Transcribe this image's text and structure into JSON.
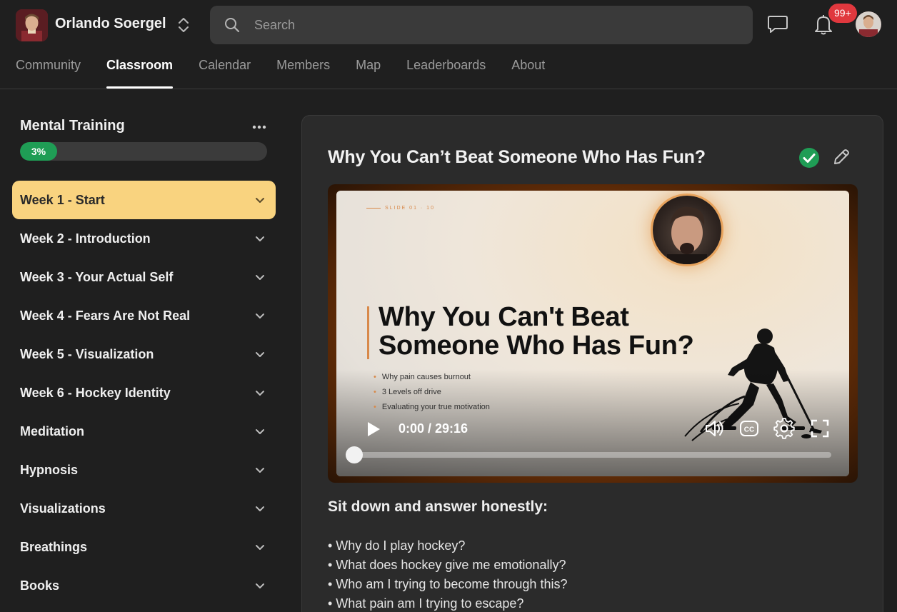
{
  "header": {
    "group_name": "Orlando Soergel",
    "search_placeholder": "Search",
    "notifications_badge": "99+",
    "tabs": [
      {
        "label": "Community",
        "active": false
      },
      {
        "label": "Classroom",
        "active": true
      },
      {
        "label": "Calendar",
        "active": false
      },
      {
        "label": "Members",
        "active": false
      },
      {
        "label": "Map",
        "active": false
      },
      {
        "label": "Leaderboards",
        "active": false
      },
      {
        "label": "About",
        "active": false
      }
    ]
  },
  "sidebar": {
    "course_title": "Mental Training",
    "progress_label": "3%",
    "progress_percent": 3,
    "modules": [
      {
        "label": "Week 1 - Start",
        "active": true
      },
      {
        "label": "Week 2 - Introduction",
        "active": false
      },
      {
        "label": "Week 3 - Your Actual Self",
        "active": false
      },
      {
        "label": "Week 4 - Fears Are Not Real",
        "active": false
      },
      {
        "label": "Week 5 - Visualization",
        "active": false
      },
      {
        "label": "Week 6 - Hockey Identity",
        "active": false
      },
      {
        "label": "Meditation",
        "active": false
      },
      {
        "label": "Hypnosis",
        "active": false
      },
      {
        "label": "Visualizations",
        "active": false
      },
      {
        "label": "Breathings",
        "active": false
      },
      {
        "label": "Books",
        "active": false
      }
    ]
  },
  "lesson": {
    "title": "Why You Can’t Beat Someone Who Has Fun?",
    "completed": true,
    "video": {
      "slide_label": "SLIDE 01 · 10",
      "slide_heading": "Why You Can't Beat Someone Who Has Fun?",
      "bullets": [
        "Why pain causes burnout",
        "3 Levels off drive",
        "Evaluating your true motivation"
      ],
      "time": "0:00 / 29:16",
      "progress": 0
    },
    "section_title": "Sit down and answer honestly:",
    "questions": [
      "• Why do I play hockey?",
      "• What does hockey give me emotionally?",
      "• Who am I trying to become through this?",
      "• What pain am I trying to escape?"
    ]
  },
  "colors": {
    "accent_active_module": "#f9d37f",
    "progress_green": "#1f9d55",
    "badge_red": "#e0383e",
    "slide_accent": "#d8894a"
  },
  "icons": [
    "switch-icon",
    "search-icon",
    "chat-icon",
    "bell-icon",
    "more-icon",
    "chevron-down-icon",
    "check-icon",
    "edit-icon",
    "play-icon",
    "volume-icon",
    "cc-icon",
    "gear-icon",
    "fullscreen-icon"
  ]
}
